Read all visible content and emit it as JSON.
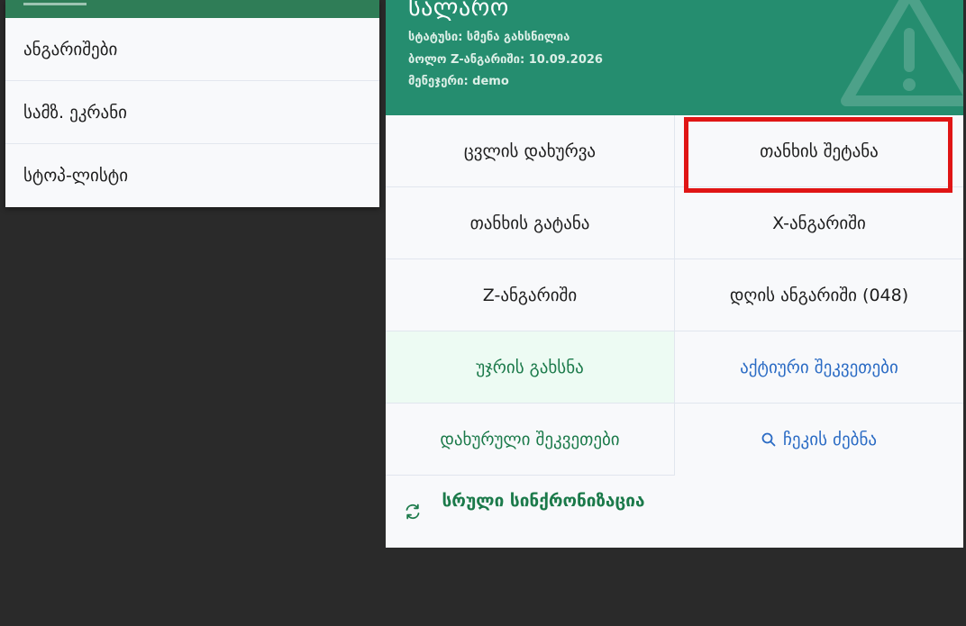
{
  "left_menu": {
    "items": [
      {
        "label": "ანგარიშები"
      },
      {
        "label": "სამზ. ეკრანი"
      },
      {
        "label": "სტოპ-ლისტი"
      }
    ]
  },
  "panel": {
    "title": "სალარო",
    "status_line": "სტატუსი: სმენა გახსნილია",
    "last_z_line": "ბოლო Z-ანგარიში: 10.09.2026",
    "manager_line": "მენეჯერი: demo",
    "buttons": {
      "close_shift": "ცვლის დახურვა",
      "cash_in": "თანხის შეტანა",
      "cash_out": "თანხის გატანა",
      "x_report": "X-ანგარიში",
      "z_report": "Z-ანგარიში",
      "day_report": "დღის ანგარიში (048)",
      "open_drawer": "უჯრის გახსნა",
      "active_orders": "აქტიური შეკვეთები",
      "closed_orders": "დახურული შეკვეთები",
      "check_search": "ჩეკის ძებნა",
      "full_sync": "სრული სინქრონიზაცია"
    }
  },
  "colors": {
    "header_green": "#258d6f",
    "accent_green": "#1b7a4a",
    "accent_blue": "#2a6bc4",
    "highlight_red": "#e01515",
    "background": "#2a2a2a"
  },
  "icons": {
    "header": "warning-triangle-icon",
    "search": "search-icon",
    "sync": "sync-icon"
  }
}
